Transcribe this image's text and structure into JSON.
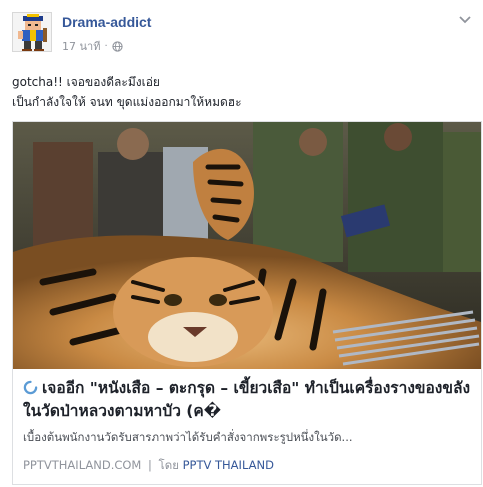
{
  "post": {
    "author": "Drama-addict",
    "time": "17 นาที",
    "separator": "·",
    "privacy_icon": "globe-icon",
    "message_lines": [
      "gotcha!! เจอของดีละมึงเอ่ย",
      "เป็นกำลังใจให้ จนท ขุดแม่งออกมาให้หมดฮะ"
    ]
  },
  "link_card": {
    "image_icon": "tiger-skin-photo",
    "title": "เจออีก \"หนังเสือ – ตะกรุด – เขี้ยวเสือ\" ทำเป็นเครื่องรางของขลัง ในวัดป่าหลวงตามหาบัว (ค�",
    "description": "เบื้องต้นพนักงานวัดรับสารภาพว่าได้รับคำสั่งจากพระรูปหนึ่งในวัด...",
    "domain": "PPTVTHAILAND.COM",
    "footer_separator": "|",
    "by_prefix": "โดย",
    "by_name": "PPTV THAILAND"
  },
  "colors": {
    "link_blue": "#365899",
    "meta_gray": "#90949c",
    "text_dark": "#1d2129",
    "card_border": "#dddfe2"
  }
}
